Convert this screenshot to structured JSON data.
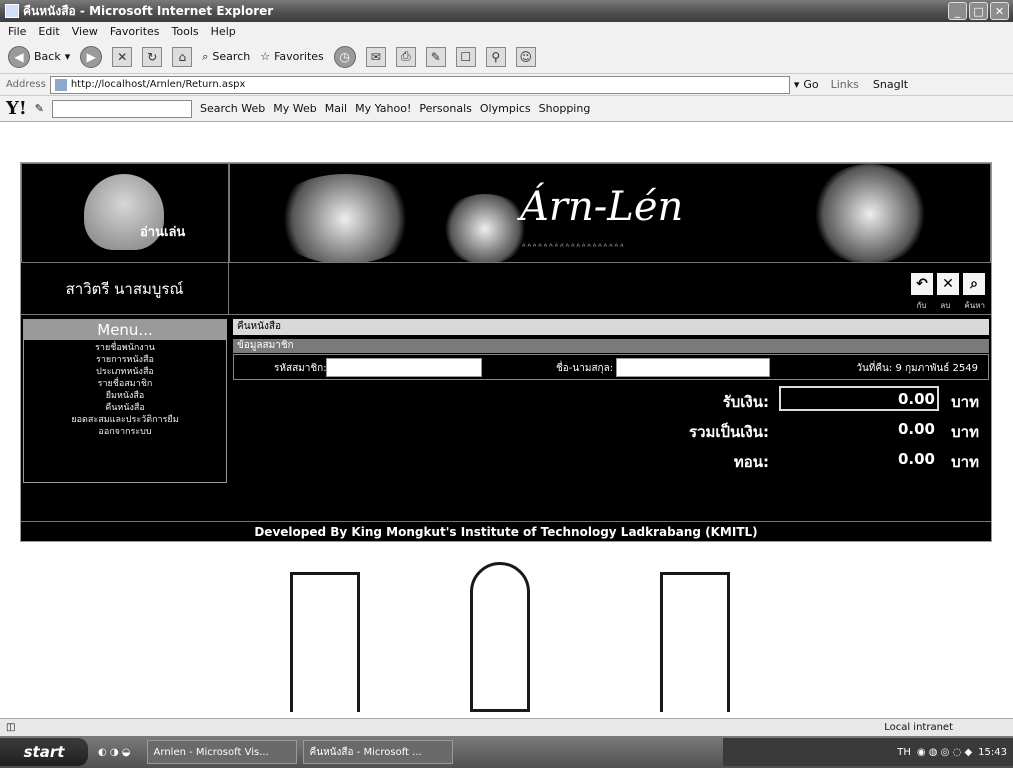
{
  "window": {
    "title": "คืนหนังสือ - Microsoft Internet Explorer"
  },
  "menubar": [
    "File",
    "Edit",
    "View",
    "Favorites",
    "Tools",
    "Help"
  ],
  "toolbar": {
    "back_label": "Back",
    "search_label": "Search",
    "favorites_label": "Favorites"
  },
  "address": {
    "label": "Address",
    "url": "http://localhost/Arnlen/Return.aspx",
    "go_label": "Go",
    "links_label": "Links",
    "snagit_label": "SnagIt"
  },
  "yahoo": {
    "logo": "Y!",
    "search_label": "Search Web",
    "items": [
      "My Web",
      "Mail",
      "My Yahoo!",
      "Personals",
      "Olympics",
      "Shopping"
    ]
  },
  "site": {
    "logo_text": "อ่านเล่น",
    "banner_title": "Árn-Lén",
    "banner_dots": "ᴬᴬᴬᴬᴬᴬᴬᴬᴬᴬᴬᴬᴬᴬᴬᴬᴬᴬᴬ",
    "user_name": "สาวิตรี นาสมบูรณ์",
    "tool_labels": [
      "กับ",
      "ลบ",
      "ค้นหา"
    ]
  },
  "menu": {
    "title": "Menu...",
    "items": [
      "รายชื่อพนักงาน",
      "รายการหนังสือ",
      "ประเภทหนังสือ",
      "รายชื่อสมาชิก",
      "ยืมหนังสือ",
      "คืนหนังสือ",
      "ยอดสะสมและประวัติการยืม",
      "ออกจากระบบ"
    ]
  },
  "form": {
    "section_title": "คืนหนังสือ",
    "member_header": "ข้อมูลสมาชิก",
    "member_id_label": "รหัสสมาชิก:",
    "member_name_label": "ชื่อ-นามสกุล:",
    "date_text": "วันที่คืน: 9 กุมภาพันธ์ 2549",
    "receive_label": "รับเงิน:",
    "receive_value": "0.00",
    "total_label": "รวมเป็นเงิน:",
    "total_value": "0.00",
    "change_label": "ทอน:",
    "change_value": "0.00",
    "unit": "บาท"
  },
  "footer": "Developed By King Mongkut's Institute of Technology Ladkrabang (KMITL)",
  "status": {
    "zone": "Local intranet"
  },
  "taskbar": {
    "start_label": "start",
    "tasks": [
      "Arnlen - Microsoft Vis...",
      "คืนหนังสือ - Microsoft ..."
    ],
    "lang": "TH",
    "clock": "15:43"
  }
}
